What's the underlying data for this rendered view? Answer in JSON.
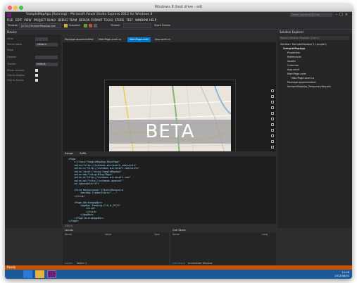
{
  "mac_window": {
    "title": "Windows 8 (test drive - ed)"
  },
  "vs": {
    "title": "SampleMapApp (Running) - Microsoft Visual Studio Express 2012 for Windows 8",
    "quick_launch": "Quick Launch (Ctrl+Q)",
    "menu": [
      "FILE",
      "EDIT",
      "VIEW",
      "PROJECT",
      "BUILD",
      "DEBUG",
      "TEAM",
      "DESIGN",
      "FORMAT",
      "TOOLS",
      "STORE",
      "TEST",
      "WINDOW",
      "HELP"
    ],
    "toolbar": {
      "process_label": "Process:",
      "process_value": "[4720] SampleMapApp.exe",
      "suspend_label": "Suspend",
      "thread_label": "Thread:",
      "stack_label": "Stack Frame:"
    },
    "device_panel": {
      "title": "Device",
      "rows": [
        {
          "label": "View",
          "value": ""
        },
        {
          "label": "Visual state",
          "value": "<Base>"
        },
        {
          "label": "Edge",
          "value": ""
        },
        {
          "label": "Display",
          "value": ""
        },
        {
          "label": "Theme",
          "value": "Default"
        },
        {
          "label": "Show chrome",
          "value": "check"
        },
        {
          "label": "Clip to display",
          "value": "check"
        },
        {
          "label": "Clip to frame",
          "value": "check"
        }
      ]
    },
    "doc_tabs": [
      "Package.appxmanifest",
      "MainPage.xaml.cs",
      "MainPage.xaml",
      "App.xaml.cs"
    ],
    "designer": {
      "beta_text": "BETA"
    },
    "split_tabs": {
      "design": "Design",
      "xaml": "XAML"
    },
    "xaml_lines": [
      "<Page",
      "    x:Class=\"SampleMapApp.MainPage\"",
      "    xmlns=\"http://schemas.microsoft.com/winfx\"",
      "    xmlns:x=\"http://schemas.microsoft.com/winfx\"",
      "    xmlns:local=\"using:SampleMapApp\"",
      "    xmlns:bm=\"using:Bing.Maps\"",
      "    xmlns:d=\"http://schemas.microsoft.com\"",
      "    xmlns:mc=\"http://schemas.openxml\"",
      "    mc:Ignorable=\"d\">",
      "",
      "    <Grid Background=\"{StaticResource",
      "        <bm:Map Credentials=\"...\"",
      "    </Grid>",
      "",
      "    <Page.BottomAppBar>",
      "        <AppBar Padding=\"10,0,10,0\"",
      "            <Grid>",
      "            </Grid>",
      "        </AppBar>",
      "    </Page.BottomAppBar>",
      "</Page>"
    ],
    "zoom_value": "100 %",
    "locals_panel": {
      "title": "Locals",
      "cols": [
        "Name",
        "Value",
        "Type"
      ],
      "tabs": [
        "Locals",
        "Watch 1"
      ]
    },
    "callstack_panel": {
      "title": "Call Stack",
      "cols": [
        "Name",
        "Lang"
      ],
      "tabs": [
        "Call Stack",
        "Immediate Window"
      ]
    },
    "solution_panel": {
      "title": "Solution Explorer",
      "search": "Search Solution Explorer (Ctrl+;)",
      "items": [
        "Solution 'SampleMapApp' (1 project)",
        "SampleMapApp",
        "Properties",
        "References",
        "Assets",
        "Common",
        "App.xaml",
        "MainPage.xaml",
        "MainPage.xaml.cs",
        "Package.appxmanifest",
        "SampleMapApp_TemporaryKey.pfx"
      ]
    },
    "status": "Ready"
  },
  "taskbar": {
    "time": "11:06",
    "date": "2012/08/31"
  },
  "colors": {
    "accent": "#ca5100",
    "taskbar": "#1b5a9a",
    "vs_dark": "#2d2d30"
  }
}
